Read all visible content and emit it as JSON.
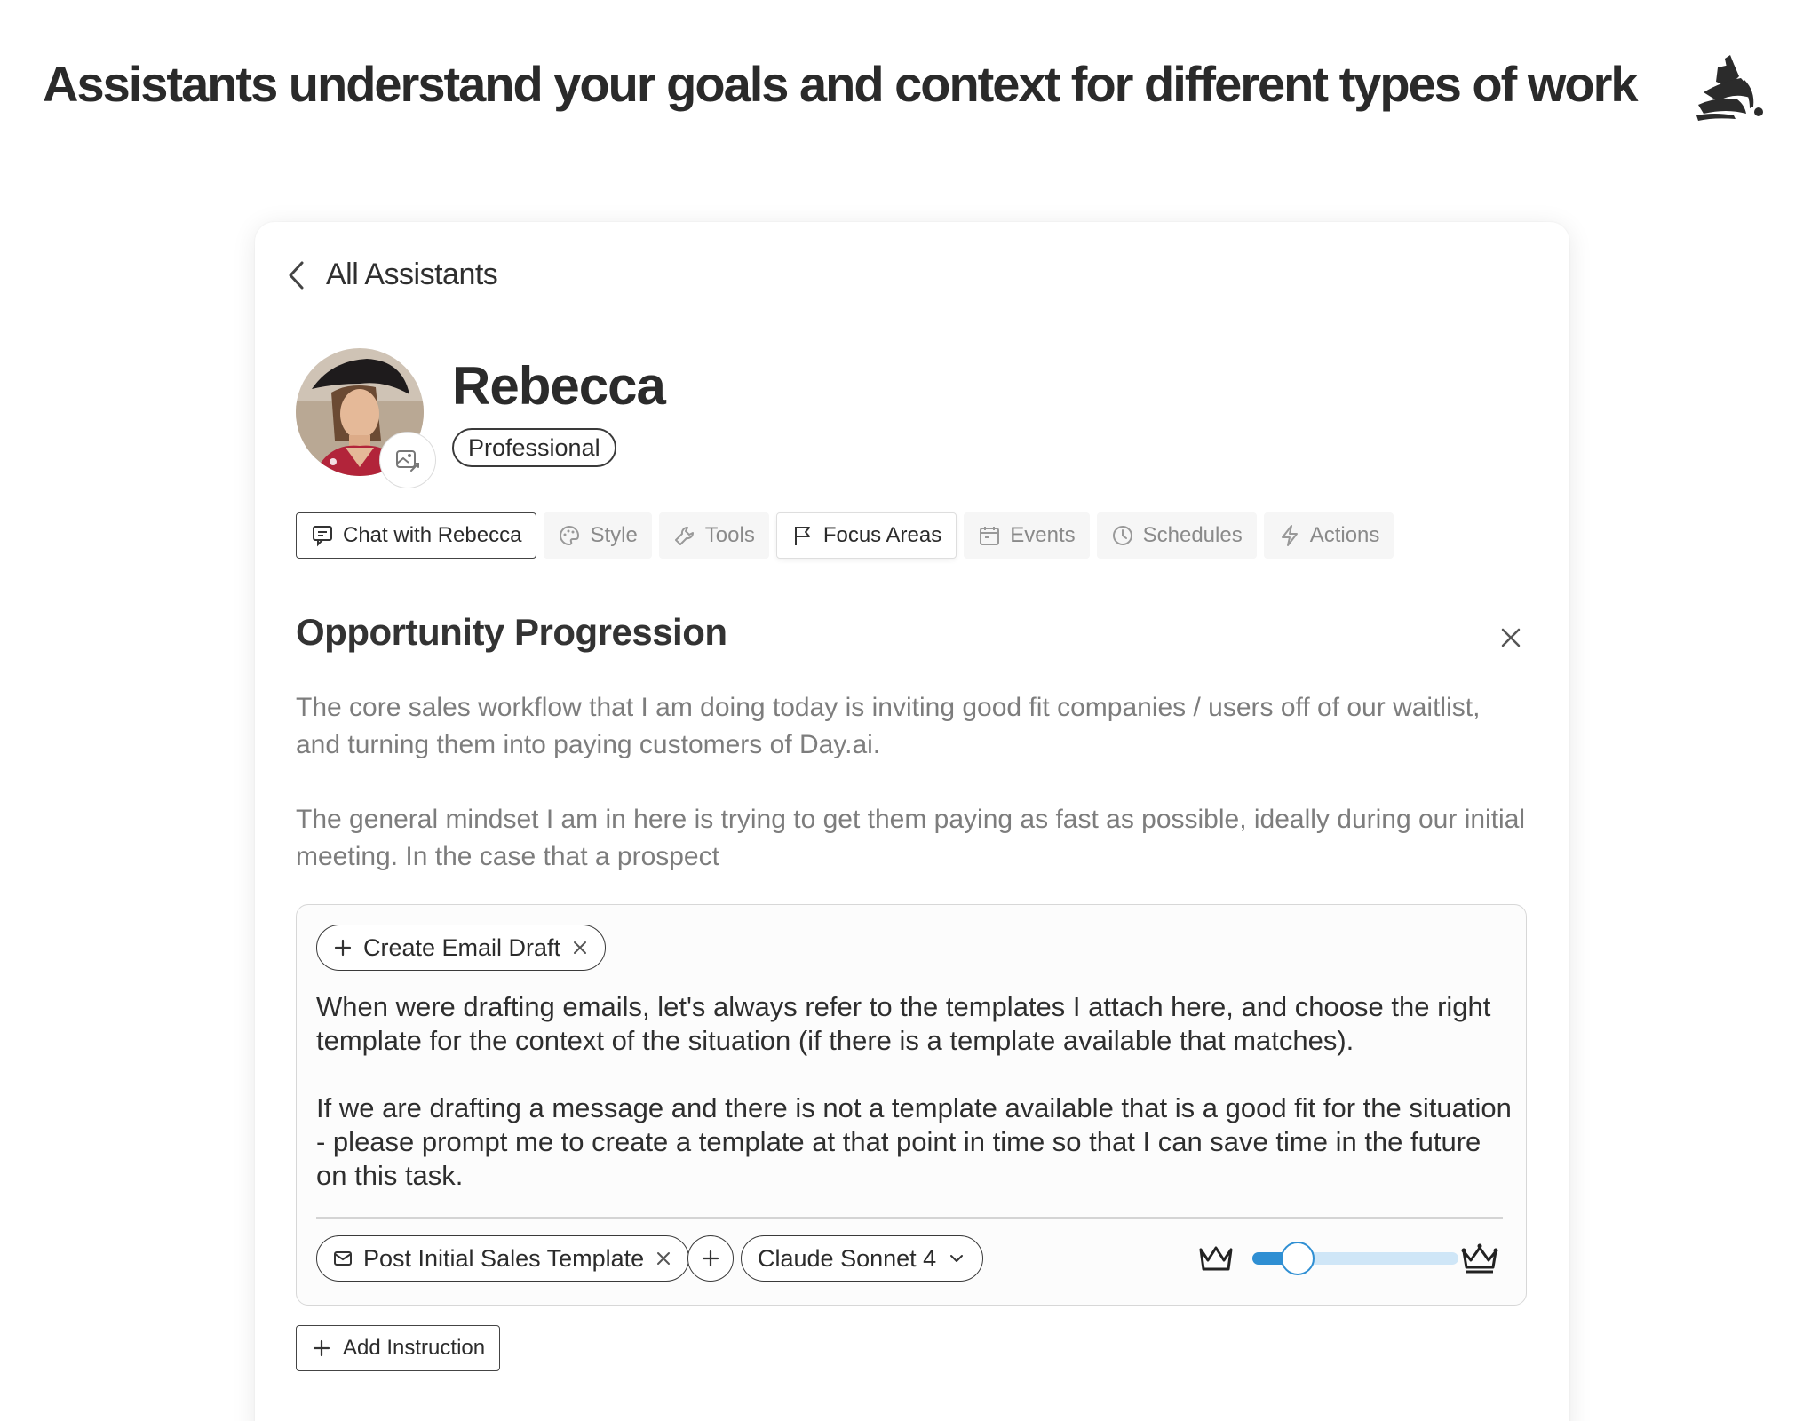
{
  "headline": "Assistants understand your goals and context for different types of work",
  "back_label": "All Assistants",
  "assistant": {
    "name": "Rebecca",
    "badge": "Professional"
  },
  "tabs": [
    {
      "label": "Chat with Rebecca",
      "icon": "chat-icon"
    },
    {
      "label": "Style",
      "icon": "palette-icon"
    },
    {
      "label": "Tools",
      "icon": "wrench-icon"
    },
    {
      "label": "Focus Areas",
      "icon": "flag-icon"
    },
    {
      "label": "Events",
      "icon": "calendar-icon"
    },
    {
      "label": "Schedules",
      "icon": "clock-icon"
    },
    {
      "label": "Actions",
      "icon": "lightning-icon"
    }
  ],
  "active_tab": "Focus Areas",
  "focus_area": {
    "title": "Opportunity Progression",
    "description": [
      "The core sales workflow that I am doing today is inviting good fit companies / users off of our waitlist, and turning them into paying customers of Day.ai.",
      "The general mindset I am in here is trying to get them paying as fast as possible, ideally during our initial meeting. In the case that a prospect"
    ]
  },
  "instruction": {
    "action_label": "Create Email Draft",
    "paragraphs": [
      "When were drafting emails, let's always refer to the templates I attach here, and choose the right template for the context of the situation (if there is a template available that matches).",
      "If we are drafting a message and there is not a template available that is a good fit for the situation - please prompt me to create a template at that point in time so that I can save time in the future on this task."
    ],
    "template_label": "Post Initial Sales Template",
    "model_label": "Claude Sonnet 4",
    "quality_level": 0.22
  },
  "add_instruction_label": "Add Instruction",
  "colors": {
    "accent": "#2f8fd3",
    "accent_light": "#cfe6f7",
    "text": "#2b2b2b",
    "muted": "#7d7d7d"
  }
}
